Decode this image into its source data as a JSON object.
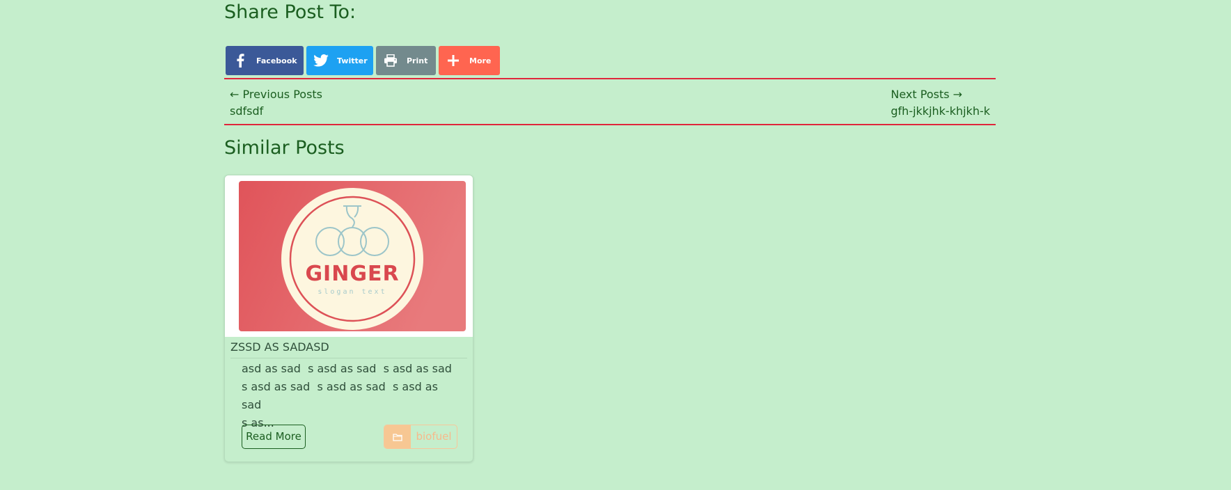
{
  "share": {
    "title": "Share Post To:",
    "buttons": [
      {
        "label": "Facebook",
        "icon": "facebook-icon",
        "color": "#3b5998"
      },
      {
        "label": "Twitter",
        "icon": "twitter-icon",
        "color": "#1da1f2"
      },
      {
        "label": "Print",
        "icon": "print-icon",
        "color": "#738a8d"
      },
      {
        "label": "More",
        "icon": "plus-icon",
        "color": "#ff6550"
      }
    ]
  },
  "post_nav": {
    "previous_label": "← Previous Posts",
    "previous_title": "sdfsdf",
    "next_label": "Next Posts →",
    "next_title": "gfh-jkkjhk-khjkh-k"
  },
  "similar": {
    "title": "Similar Posts",
    "cards": [
      {
        "image_logo_text": "GINGER",
        "image_slogan_text": "slogan text",
        "title": "ZSSD AS SADASD",
        "excerpt": "asd as sad  s asd as sad  s asd as sad\ns asd as sad  s asd as sad  s asd as sad\ns as...",
        "read_more": "Read More",
        "category": "biofuel",
        "category_icon": "folder-icon"
      }
    ]
  },
  "colors": {
    "background": "#c5eecc",
    "text": "#1b5e20",
    "divider": "#e0263b",
    "category": "#f7c793"
  }
}
